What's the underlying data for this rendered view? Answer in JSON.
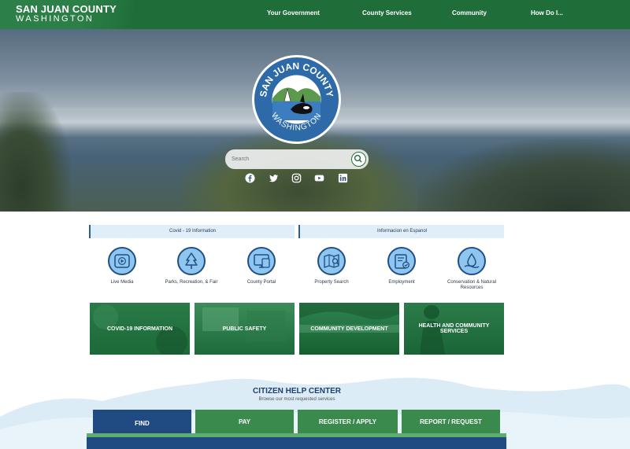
{
  "header": {
    "logo": {
      "line1": "SAN JUAN COUNTY",
      "line2": "WASHINGTON"
    },
    "nav": [
      "Your Government",
      "County Services",
      "Community",
      "How Do I..."
    ]
  },
  "hero": {
    "seal": {
      "top_text": "SAN JUAN COUNTY",
      "bottom_text": "WASHINGTON"
    },
    "search": {
      "placeholder": "Search"
    },
    "social_icons": [
      "facebook-icon",
      "twitter-icon",
      "instagram-icon",
      "youtube-icon",
      "linkedin-icon"
    ]
  },
  "info_bars": [
    "Covid - 19 Information",
    "Informacion en Espanol"
  ],
  "quick_links": [
    {
      "label": "Live Media",
      "icon": "play-icon"
    },
    {
      "label": "Parks, Recreation, & Fair",
      "icon": "tree-icon"
    },
    {
      "label": "County Portal",
      "icon": "portal-icon"
    },
    {
      "label": "Property Search",
      "icon": "map-search-icon"
    },
    {
      "label": "Employment",
      "icon": "employment-icon"
    },
    {
      "label": "Conservation & Natural Resources",
      "icon": "water-drop-icon"
    }
  ],
  "tiles": [
    "COVID-19 INFORMATION",
    "PUBLIC SAFETY",
    "COMMUNITY DEVELOPMENT",
    "HEALTH AND COMMUNITY SERVICES"
  ],
  "help_center": {
    "title": "CITIZEN HELP CENTER",
    "subtitle": "Browse our most requested services",
    "tabs": [
      "FIND",
      "PAY",
      "REGISTER / APPLY",
      "REPORT / REQUEST"
    ],
    "active_tab": "FIND"
  },
  "colors": {
    "header_green": "#1f6e3a",
    "tab_active": "#1f4a82",
    "tab_inactive": "#3a8a4e",
    "icon_fill": "#8ec6ef",
    "icon_border": "#1f4f86"
  }
}
